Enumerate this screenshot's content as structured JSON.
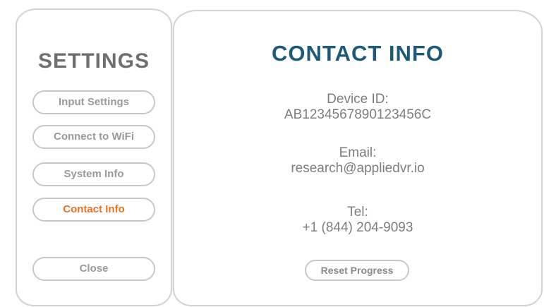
{
  "sidebar": {
    "title": "SETTINGS",
    "items": [
      {
        "label": "Input Settings"
      },
      {
        "label": "Connect to WiFi"
      },
      {
        "label": "System Info"
      },
      {
        "label": "Contact Info",
        "active": true
      }
    ],
    "close_label": "Close"
  },
  "main": {
    "title": "CONTACT INFO",
    "device": {
      "label": "Device ID:",
      "value": "AB1234567890123456C"
    },
    "email": {
      "label": "Email:",
      "value": "research@appliedvr.io"
    },
    "tel": {
      "label": "Tel:",
      "value": "+1 (844) 204-9093"
    },
    "reset_label": "Reset Progress"
  },
  "colors": {
    "accent": "#e8731f",
    "heading": "#1b5a78",
    "sidebar_heading": "#6f6f6f",
    "muted_text": "#9a9a9a",
    "border": "#c8c8c8"
  }
}
